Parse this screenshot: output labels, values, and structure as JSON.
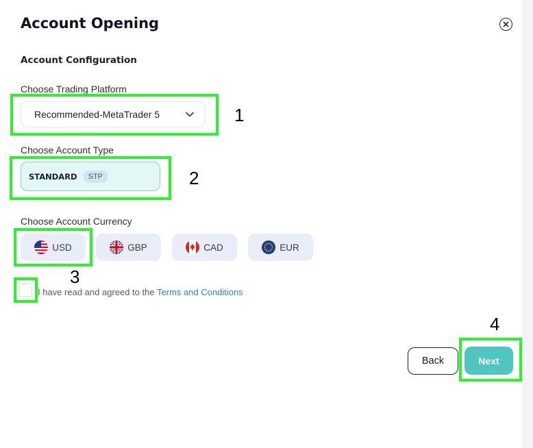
{
  "header": {
    "title": "Account Opening",
    "close_icon": "close-circle-icon"
  },
  "config": {
    "section_title": "Account Configuration",
    "platform": {
      "label": "Choose Trading Platform",
      "selected": "Recommended-MetaTrader 5"
    },
    "account_type": {
      "label": "Choose Account Type",
      "name": "STANDARD",
      "badge": "STP"
    },
    "currency": {
      "label": "Choose Account Currency",
      "options": [
        {
          "code": "USD",
          "icon": "us-flag-icon"
        },
        {
          "code": "GBP",
          "icon": "uk-flag-icon"
        },
        {
          "code": "CAD",
          "icon": "canada-flag-icon"
        },
        {
          "code": "EUR",
          "icon": "eu-flag-icon"
        }
      ]
    },
    "terms": {
      "prefix": "I have read and agreed to the ",
      "link": "Terms and Conditions",
      "checked": false
    }
  },
  "footer": {
    "back_label": "Back",
    "next_label": "Next"
  },
  "annotations": {
    "color": "#2bf32b",
    "numbers": [
      "1",
      "2",
      "3",
      "4"
    ]
  }
}
